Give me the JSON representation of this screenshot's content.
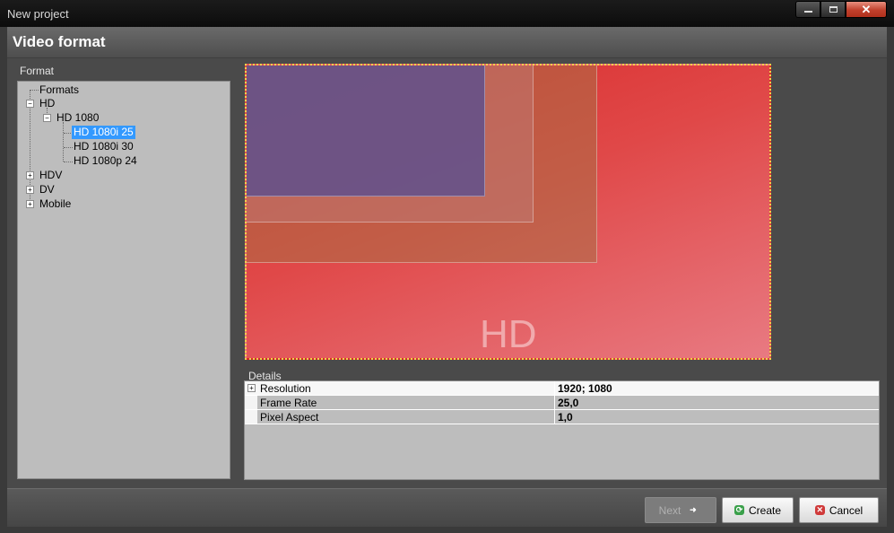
{
  "window": {
    "title": "New project",
    "close_glyph": "✕"
  },
  "header": {
    "title": "Video format"
  },
  "format_panel": {
    "label": "Format",
    "tree": {
      "root": "Formats",
      "hd": "HD",
      "hd1080": "HD 1080",
      "hd1080i25": "HD 1080i 25",
      "hd1080i30": "HD 1080i 30",
      "hd1080p24": "HD 1080p 24",
      "hdv": "HDV",
      "dv": "DV",
      "mobile": "Mobile"
    },
    "selected": "HD 1080i 25",
    "expander_open": "−",
    "expander_closed": "+"
  },
  "preview": {
    "overlay_text": "HD"
  },
  "details": {
    "label": "Details",
    "rows": [
      {
        "label": "Resolution",
        "value": "1920; 1080",
        "expander": "+"
      },
      {
        "label": "Frame Rate",
        "value": "25,0"
      },
      {
        "label": "Pixel Aspect",
        "value": "1,0"
      }
    ]
  },
  "buttons": {
    "next": "Next",
    "create": "Create",
    "cancel": "Cancel",
    "create_glyph": "⟳",
    "cancel_glyph": "✕",
    "next_glyph": "➜"
  },
  "colors": {
    "selection": "#3399ff",
    "preview_red": "#d82a2a",
    "safe_area_purple": "#5f508c",
    "frame_dots": "#f2d24a"
  }
}
